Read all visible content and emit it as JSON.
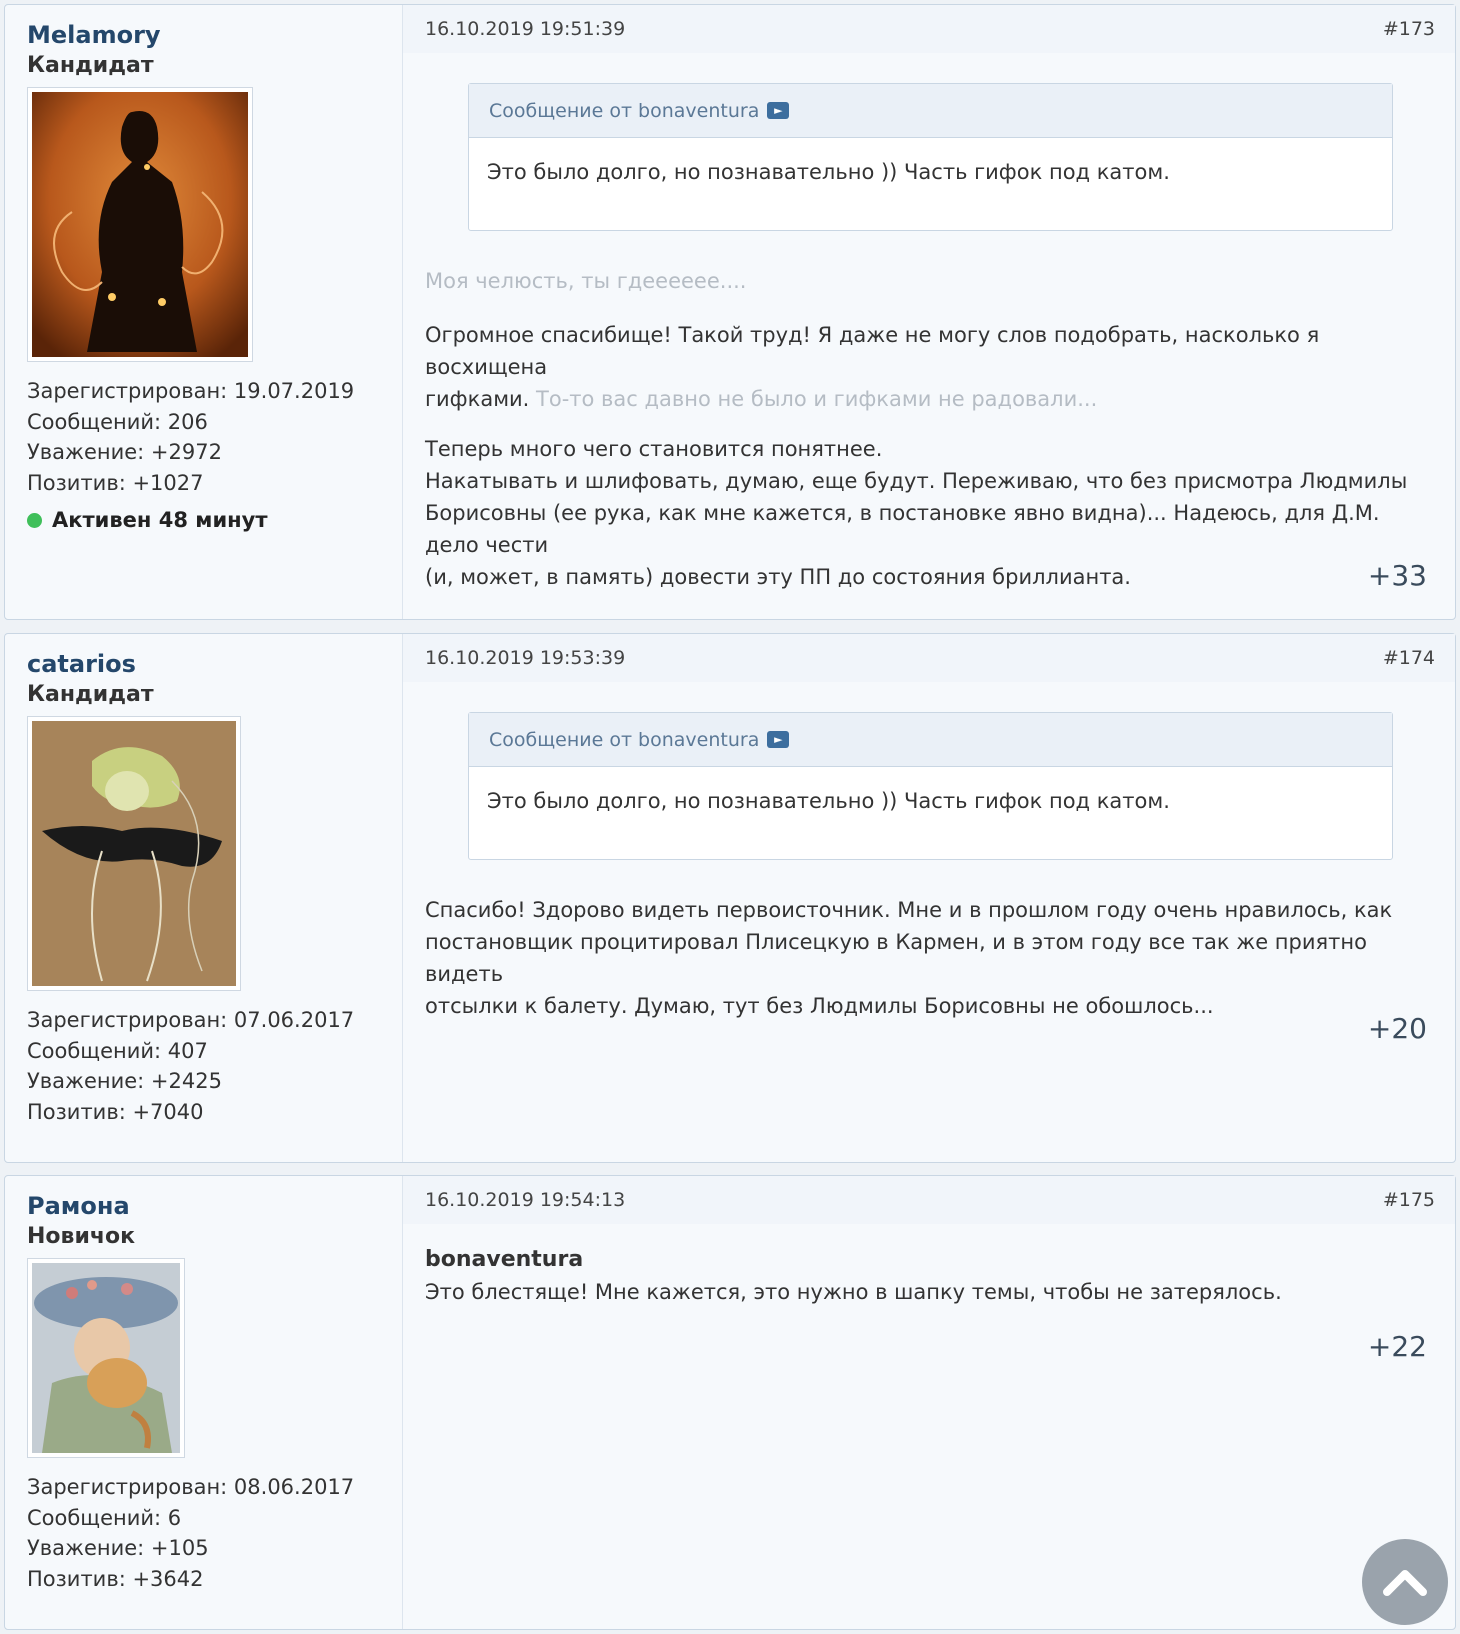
{
  "posts": [
    {
      "username": "Melamory",
      "rank": "Кандидат",
      "registered": "Зарегистрирован: 19.07.2019",
      "messages": "Сообщений: 206",
      "respect": "Уважение: +2972",
      "positive": "Позитив: +1027",
      "online": "Активен 48 минут",
      "datetime": "16.10.2019 19:51:39",
      "number": "#173",
      "quote_header": "Сообщение от bonaventura",
      "quote_text": "Это было долго, но познавательно )) Часть гифок под катом.",
      "faded_line": "Моя челюсть, ты гдееееее....",
      "para1": "Огромное спасибище! Такой труд! Я даже не могу слов подобрать, насколько я восхищена",
      "para1b": "гифками.",
      "para1_faded": "То-то вас давно не было и гифками не радовали...",
      "para2_1": "Теперь много чего становится понятнее.",
      "para2_2": "Накатывать и шлифовать, думаю, еще будут. Переживаю, что без присмотра Людмилы",
      "para2_3": "Борисовны (ее рука, как мне кажется, в постановке явно видна)... Надеюсь, для Д.М. дело чести",
      "para2_4": "(и, может, в память) довести эту ПП до состояния бриллианта.",
      "rating": "+33"
    },
    {
      "username": "catarios",
      "rank": "Кандидат",
      "registered": "Зарегистрирован: 07.06.2017",
      "messages": "Сообщений: 407",
      "respect": "Уважение: +2425",
      "positive": "Позитив: +7040",
      "datetime": "16.10.2019 19:53:39",
      "number": "#174",
      "quote_header": "Сообщение от bonaventura",
      "quote_text": "Это было долго, но познавательно )) Часть гифок под катом.",
      "line1": "Спасибо! Здорово видеть первоисточник. Мне и в прошлом году очень нравилось, как",
      "line2": "постановщик процитировал Плисецкую в Кармен, и в этом году все так же приятно видеть",
      "line3": "отсылки к балету. Думаю, тут без Людмилы Борисовны не обошлось...",
      "rating": "+20"
    },
    {
      "username": "Рамона",
      "rank": "Новичок",
      "registered": "Зарегистрирован: 08.06.2017",
      "messages": "Сообщений: 6",
      "respect": "Уважение: +105",
      "positive": "Позитив: +3642",
      "datetime": "16.10.2019 19:54:13",
      "number": "#175",
      "author": "bonaventura",
      "line1": "Это блестяще! Мне кажется, это нужно в шапку темы, чтобы не затерялось.",
      "rating": "+22"
    }
  ],
  "scroll_top_icon": "chevron-up-icon"
}
